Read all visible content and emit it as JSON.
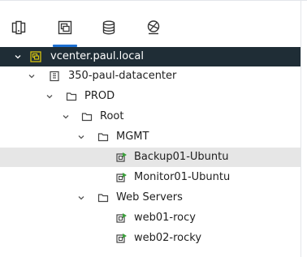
{
  "tabs": [
    {
      "name": "Hosts and Clusters",
      "icon": "hosts-clusters-icon",
      "active": false
    },
    {
      "name": "VMs and Templates",
      "icon": "vms-templates-icon",
      "active": true
    },
    {
      "name": "Storage",
      "icon": "storage-icon",
      "active": false
    },
    {
      "name": "Networking",
      "icon": "networking-icon",
      "active": false
    }
  ],
  "tree": {
    "vcenter": {
      "label": "vcenter.paul.local",
      "icon": "vcenter-icon",
      "expanded": true,
      "selected": true
    },
    "datacenter": {
      "label": "350-paul-datacenter",
      "icon": "datacenter-icon",
      "expanded": true
    },
    "prod": {
      "label": "PROD",
      "icon": "folder-icon",
      "expanded": true
    },
    "root": {
      "label": "Root",
      "icon": "folder-icon",
      "expanded": true
    },
    "mgmt": {
      "label": "MGMT",
      "icon": "folder-icon",
      "expanded": true
    },
    "backup": {
      "label": "Backup01-Ubuntu",
      "icon": "vm-running-icon",
      "hovered": true
    },
    "monitor": {
      "label": "Monitor01-Ubuntu",
      "icon": "vm-running-icon"
    },
    "webservers": {
      "label": "Web Servers",
      "icon": "folder-icon",
      "expanded": true
    },
    "web01": {
      "label": "web01-rocy",
      "icon": "vm-running-icon"
    },
    "web02": {
      "label": "web02-rocky",
      "icon": "vm-running-icon"
    }
  },
  "colors": {
    "accent": "#1d6fd1",
    "selected_bg": "#1f2d36",
    "hover_bg": "#e6e6e6",
    "vm_green": "#3aa03a",
    "vcenter_yellow": "#d7c40f"
  }
}
